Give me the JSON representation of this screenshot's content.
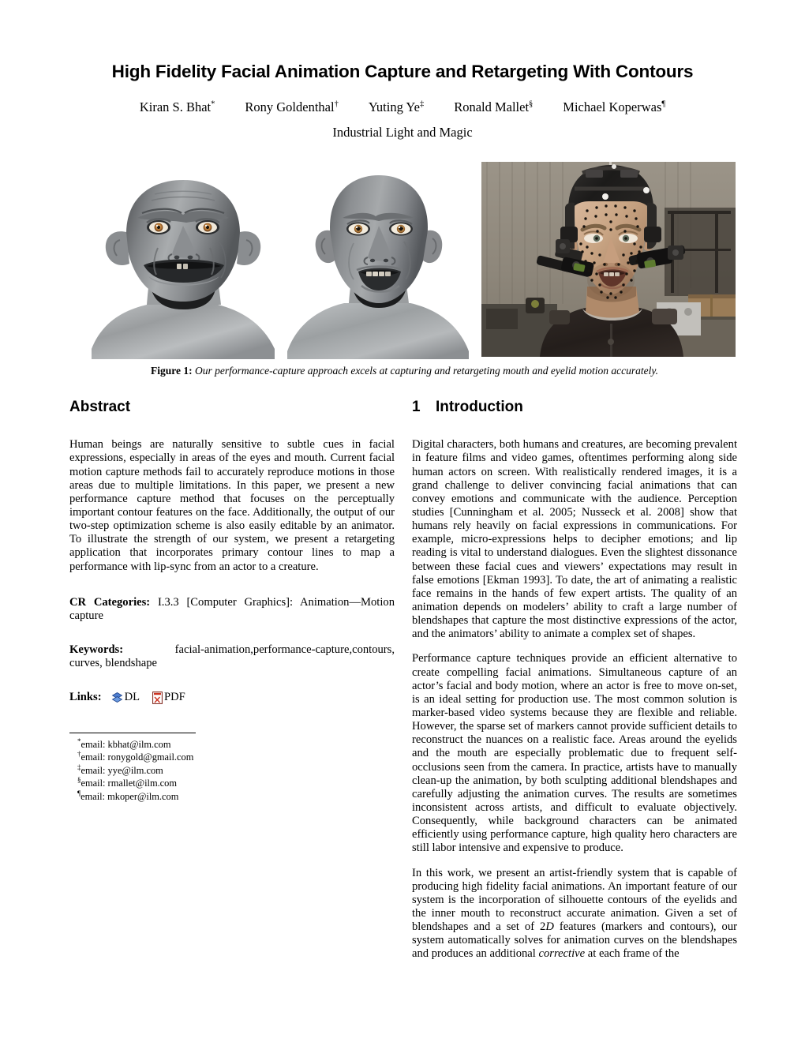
{
  "paper": {
    "title": "High Fidelity Facial Animation Capture and Retargeting With Contours",
    "authors": [
      {
        "name": "Kiran S. Bhat",
        "mark": "*"
      },
      {
        "name": "Rony Goldenthal",
        "mark": "†"
      },
      {
        "name": "Yuting Ye",
        "mark": "‡"
      },
      {
        "name": "Ronald Mallet",
        "mark": "§"
      },
      {
        "name": "Michael Koperwas",
        "mark": "¶"
      }
    ],
    "affiliation": "Industrial Light and Magic"
  },
  "figure": {
    "label": "Figure 1:",
    "caption": "Our performance-capture approach excels at capturing and retargeting mouth and eyelid motion accurately.",
    "panels": [
      {
        "name": "creature-render",
        "alt": "Grey CG creature head with amber eyes, mouth open"
      },
      {
        "name": "human-render",
        "alt": "Grey CG human head, bald, mouth open"
      },
      {
        "name": "actor-photo",
        "alt": "Actor wearing head-mounted camera rig with facial tracking markers"
      }
    ]
  },
  "abstract": {
    "heading": "Abstract",
    "body": "Human beings are naturally sensitive to subtle cues in facial expressions, especially in areas of the eyes and mouth. Current facial motion capture methods fail to accurately reproduce motions in those areas due to multiple limitations. In this paper, we present a new performance capture method that focuses on the perceptually important contour features on the face. Additionally, the output of our two-step optimization scheme is also easily editable by an animator. To illustrate the strength of our system, we present a retargeting application that incorporates primary contour lines to map a performance with lip-sync from an actor to a creature."
  },
  "cr_categories": {
    "label": "CR Categories:",
    "value": "I.3.3 [Computer Graphics]: Animation—Motion capture"
  },
  "keywords": {
    "label": "Keywords:",
    "value": "facial-animation,performance-capture,contours, curves, blendshape"
  },
  "links": {
    "label": "Links:",
    "items": [
      {
        "icon": "dl-diamond-icon",
        "text": "DL",
        "color": "#3f6fc4"
      },
      {
        "icon": "pdf-document-icon",
        "text": "PDF",
        "color": "#cc3322"
      }
    ]
  },
  "footnotes": [
    {
      "mark": "*",
      "text": "email: kbhat@ilm.com"
    },
    {
      "mark": "†",
      "text": "email: ronygold@gmail.com"
    },
    {
      "mark": "‡",
      "text": "email: yye@ilm.com"
    },
    {
      "mark": "§",
      "text": "email: rmallet@ilm.com"
    },
    {
      "mark": "¶",
      "text": "email: mkoper@ilm.com"
    }
  ],
  "introduction": {
    "number": "1",
    "heading": "Introduction",
    "paragraphs": [
      "Digital characters, both humans and creatures, are becoming prevalent in feature films and video games, oftentimes performing along side human actors on screen. With realistically rendered images, it is a grand challenge to deliver convincing facial animations that can convey emotions and communicate with the audience. Perception studies [Cunningham et al. 2005; Nusseck et al. 2008] show that humans rely heavily on facial expressions in communications. For example, micro-expressions helps to decipher emotions; and lip reading is vital to understand dialogues. Even the slightest dissonance between these facial cues and viewers’ expectations may result in false emotions [Ekman 1993]. To date, the art of animating a realistic face remains in the hands of few expert artists. The quality of an animation depends on modelers’ ability to craft a large number of blendshapes that capture the most distinctive expressions of the actor, and the animators’ ability to animate a complex set of shapes.",
      "Performance capture techniques provide an efficient alternative to create compelling facial animations. Simultaneous capture of an actor’s facial and body motion, where an actor is free to move on-set, is an ideal setting for production use. The most common solution is marker-based video systems because they are flexible and reliable. However, the sparse set of markers cannot provide sufficient details to reconstruct the nuances on a realistic face. Areas around the eyelids and the mouth are especially problematic due to frequent self-occlusions seen from the camera. In practice, artists have to manually clean-up the animation, by both sculpting additional blendshapes and carefully adjusting the animation curves. The results are sometimes inconsistent across artists, and difficult to evaluate objectively. Consequently, while background characters can be animated efficiently using performance capture, high quality hero characters are still labor intensive and expensive to produce."
    ],
    "last_paragraph_parts": [
      "In this work, we present an artist-friendly system that is capable of producing high fidelity facial animations. An important feature of our system is the incorporation of silhouette contours of the eyelids and the inner mouth to reconstruct accurate animation. Given a set of blendshapes and a set of 2",
      "D",
      " features (markers and contours), our system automatically solves for animation curves on the blendshapes and produces an additional ",
      "corrective",
      " at each frame of the"
    ]
  }
}
